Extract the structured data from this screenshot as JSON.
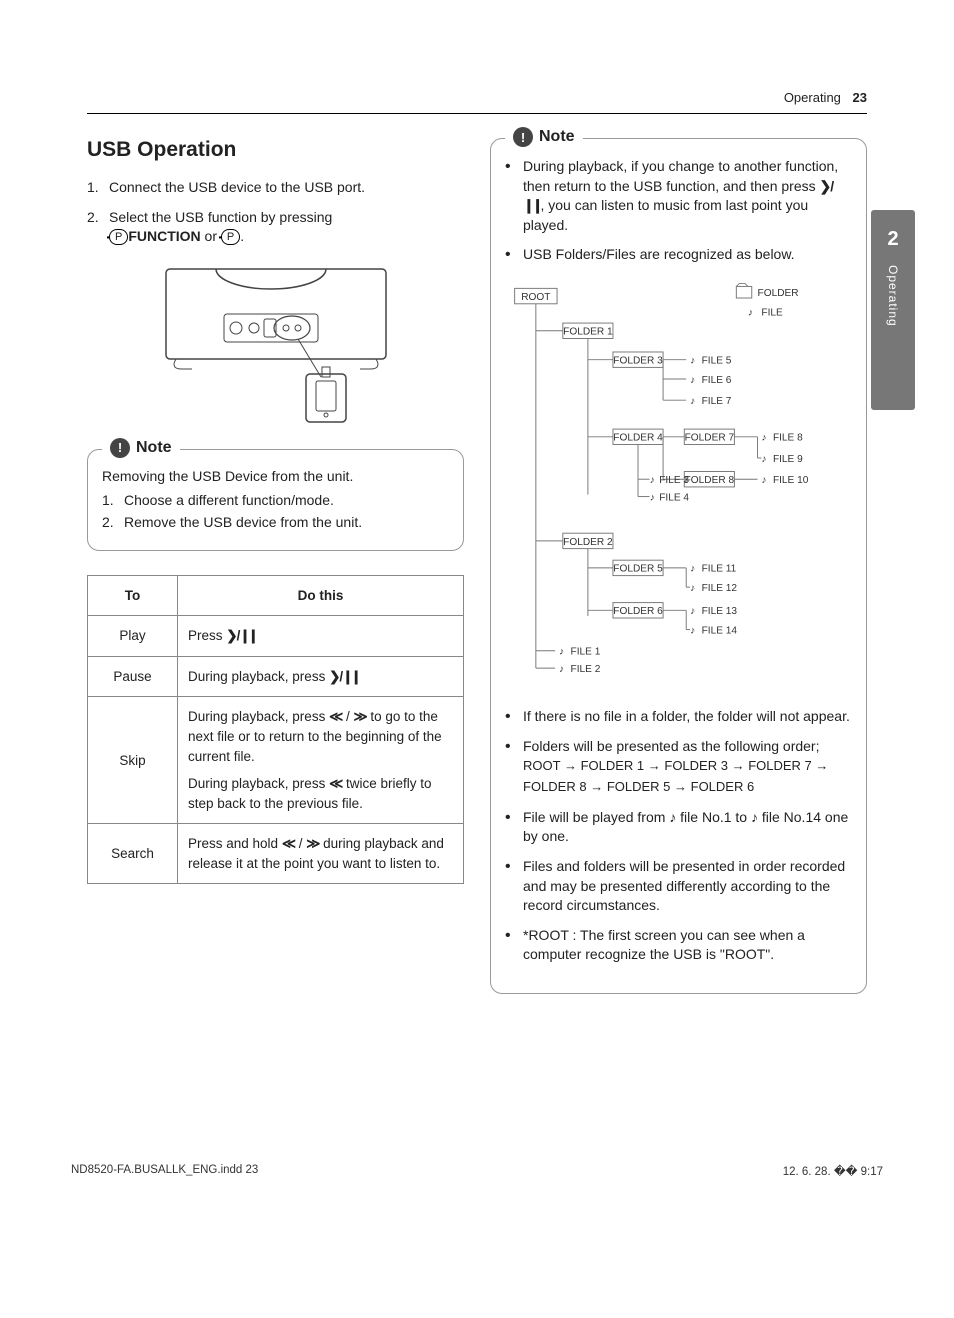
{
  "header": {
    "section": "Operating",
    "page": "23"
  },
  "sideTab": {
    "number": "2",
    "label": "Operating"
  },
  "title": "USB Operation",
  "steps": [
    "Connect the USB device to the USB port.",
    "Select the USB function by pressing"
  ],
  "step2_suffix_a": "FUNCTION",
  "step2_suffix_b": " or ",
  "step2_suffix_c": ".",
  "note1": {
    "label": "Note",
    "lead": "Removing the USB Device from the unit.",
    "items": [
      "Choose a different function/mode.",
      "Remove the USB device from the unit."
    ]
  },
  "table": {
    "head": [
      "To",
      "Do this"
    ],
    "rows": [
      {
        "k": "Play",
        "v_parts": [
          "Press ",
          "PLAYPAUSE"
        ]
      },
      {
        "k": "Pause",
        "v_parts": [
          "During playback, press ",
          "PLAYPAUSE"
        ]
      },
      {
        "k": "Skip",
        "v_parts": [
          "During playback, press ",
          "REW",
          " / ",
          "FWD",
          " to go to the next file or to return to the beginning of the current file.",
          "BR",
          "During playback, press ",
          "REW",
          " twice briefly to step back to the previous file."
        ]
      },
      {
        "k": "Search",
        "v_parts": [
          "Press and hold ",
          "REW",
          " / ",
          "FWD",
          " during playback and release it at the point you want to listen to."
        ]
      }
    ]
  },
  "note2": {
    "label": "Note",
    "bullets_top": [
      {
        "parts": [
          "During playback, if you change to another function, then return to the USB function, and then press ",
          "PLAYPAUSE",
          ", you can listen to music from last point you played."
        ]
      },
      {
        "parts": [
          "USB Folders/Files are recognized as below."
        ]
      }
    ],
    "tree": {
      "root": "ROOT",
      "legend_folder": "FOLDER",
      "legend_file": "FILE",
      "folders": [
        "FOLDER 1",
        "FOLDER 2",
        "FOLDER 3",
        "FOLDER 4",
        "FOLDER 5",
        "FOLDER 6",
        "FOLDER 7",
        "FOLDER 8"
      ],
      "files": [
        "FILE 1",
        "FILE 2",
        "FILE 3",
        "FILE 4",
        "FILE 5",
        "FILE 6",
        "FILE 7",
        "FILE 8",
        "FILE 9",
        "FILE 10",
        "FILE 11",
        "FILE 12",
        "FILE 13",
        "FILE 14"
      ]
    },
    "bullets_bottom": [
      {
        "parts": [
          "If there is no file in a folder, the folder will not appear."
        ]
      },
      {
        "parts": [
          "Folders will be presented as the following order;"
        ],
        "sub": "ROOT → FOLDER 1 → FOLDER 3 → FOLDER 7 → FOLDER 8 → FOLDER 5 → FOLDER 6"
      },
      {
        "parts": [
          "File will be played from ",
          "NOTE",
          " file No.1 to ",
          "NOTE",
          " file No.14 one by one."
        ]
      },
      {
        "parts": [
          "Files and folders will be presented in order recorded and may be presented differently according to the record circumstances."
        ]
      },
      {
        "parts": [
          "*ROOT : The first screen you can see when a computer recognize the USB is \"ROOT\"."
        ]
      }
    ]
  },
  "footer": {
    "left": "ND8520-FA.BUSALLK_ENG.indd   23",
    "right": "12. 6. 28.   �� 9:17"
  }
}
